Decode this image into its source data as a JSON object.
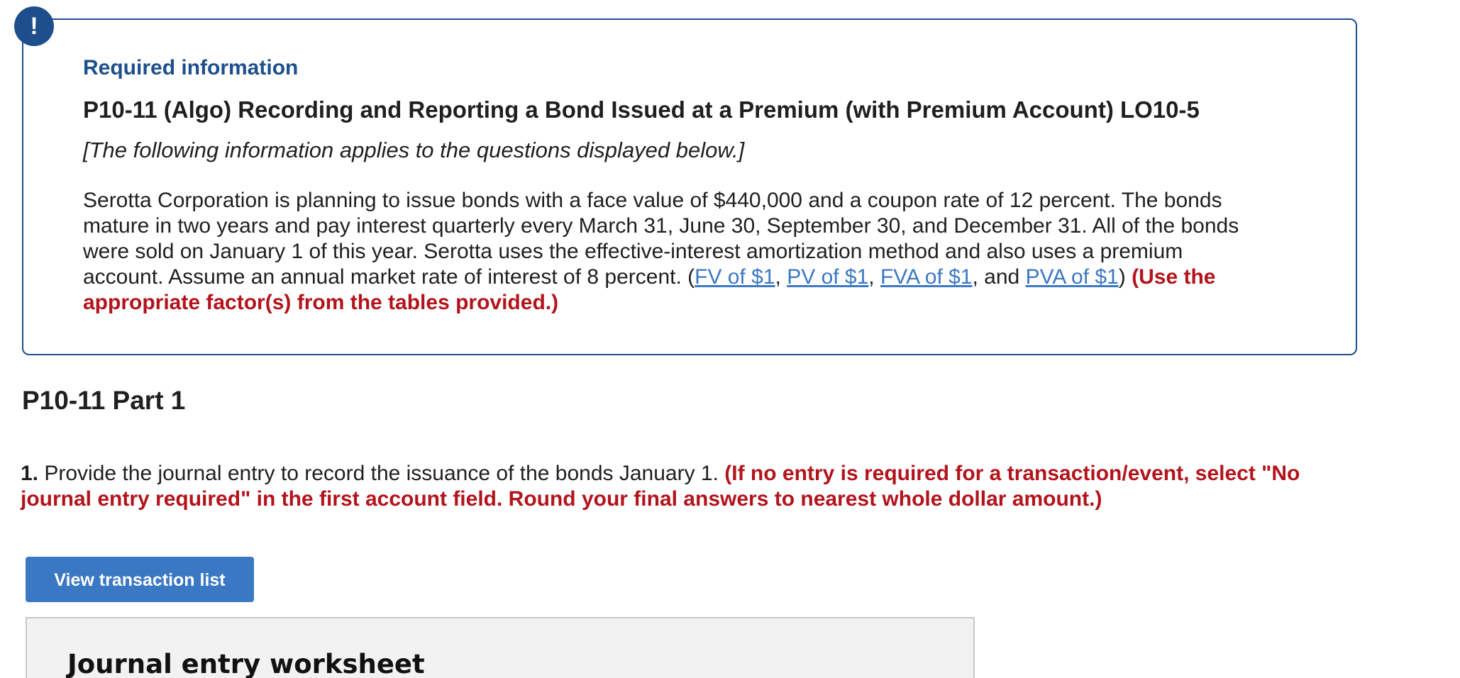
{
  "alert_badge": {
    "icon": "exclamation-icon",
    "glyph": "!",
    "color": "#1d4f8c"
  },
  "required_info": {
    "label": "Required information",
    "title": "P10-11 (Algo) Recording and Reporting a Bond Issued at a Premium (with Premium Account) LO10-5",
    "note": "[The following information applies to the questions displayed below.]",
    "scenario_lines": [
      "Serotta Corporation is planning to issue bonds with a face value of $440,000 and a coupon rate of 12 percent. The bonds",
      "mature in two years and pay interest quarterly every March 31, June 30, September 30, and December 31. All of the bonds",
      "were sold on January 1 of this year. Serotta uses the effective-interest amortization method and also uses a premium"
    ],
    "scenario_line4_prefix": "account. Assume an annual market rate of interest of 8 percent. (",
    "table_links": [
      "FV of $1",
      "PV of $1",
      "FVA of $1",
      "PVA of $1"
    ],
    "link_separators": [
      ", ",
      ", ",
      ", and "
    ],
    "scenario_line4_close": ") ",
    "instruction_line4": "(Use the",
    "instruction_line5": "appropriate factor(s) from the tables provided.)"
  },
  "part": {
    "heading": "P10-11 Part 1"
  },
  "question": {
    "number": "1.",
    "text": " Provide the journal entry to record the issuance of the bonds January 1. ",
    "instruction_line1": "(If no entry is required for a transaction/event, select \"No",
    "instruction_line2": "journal entry required\" in the first account field. Round your final answers to nearest whole dollar amount.)"
  },
  "buttons": {
    "view_transactions": "View transaction list"
  },
  "worksheet": {
    "title": "Journal entry worksheet"
  },
  "colors": {
    "brand_blue": "#1d4f8c",
    "link_blue": "#3a78c3",
    "instruction_red": "#b3141c",
    "panel_gray": "#f2f2f2"
  }
}
